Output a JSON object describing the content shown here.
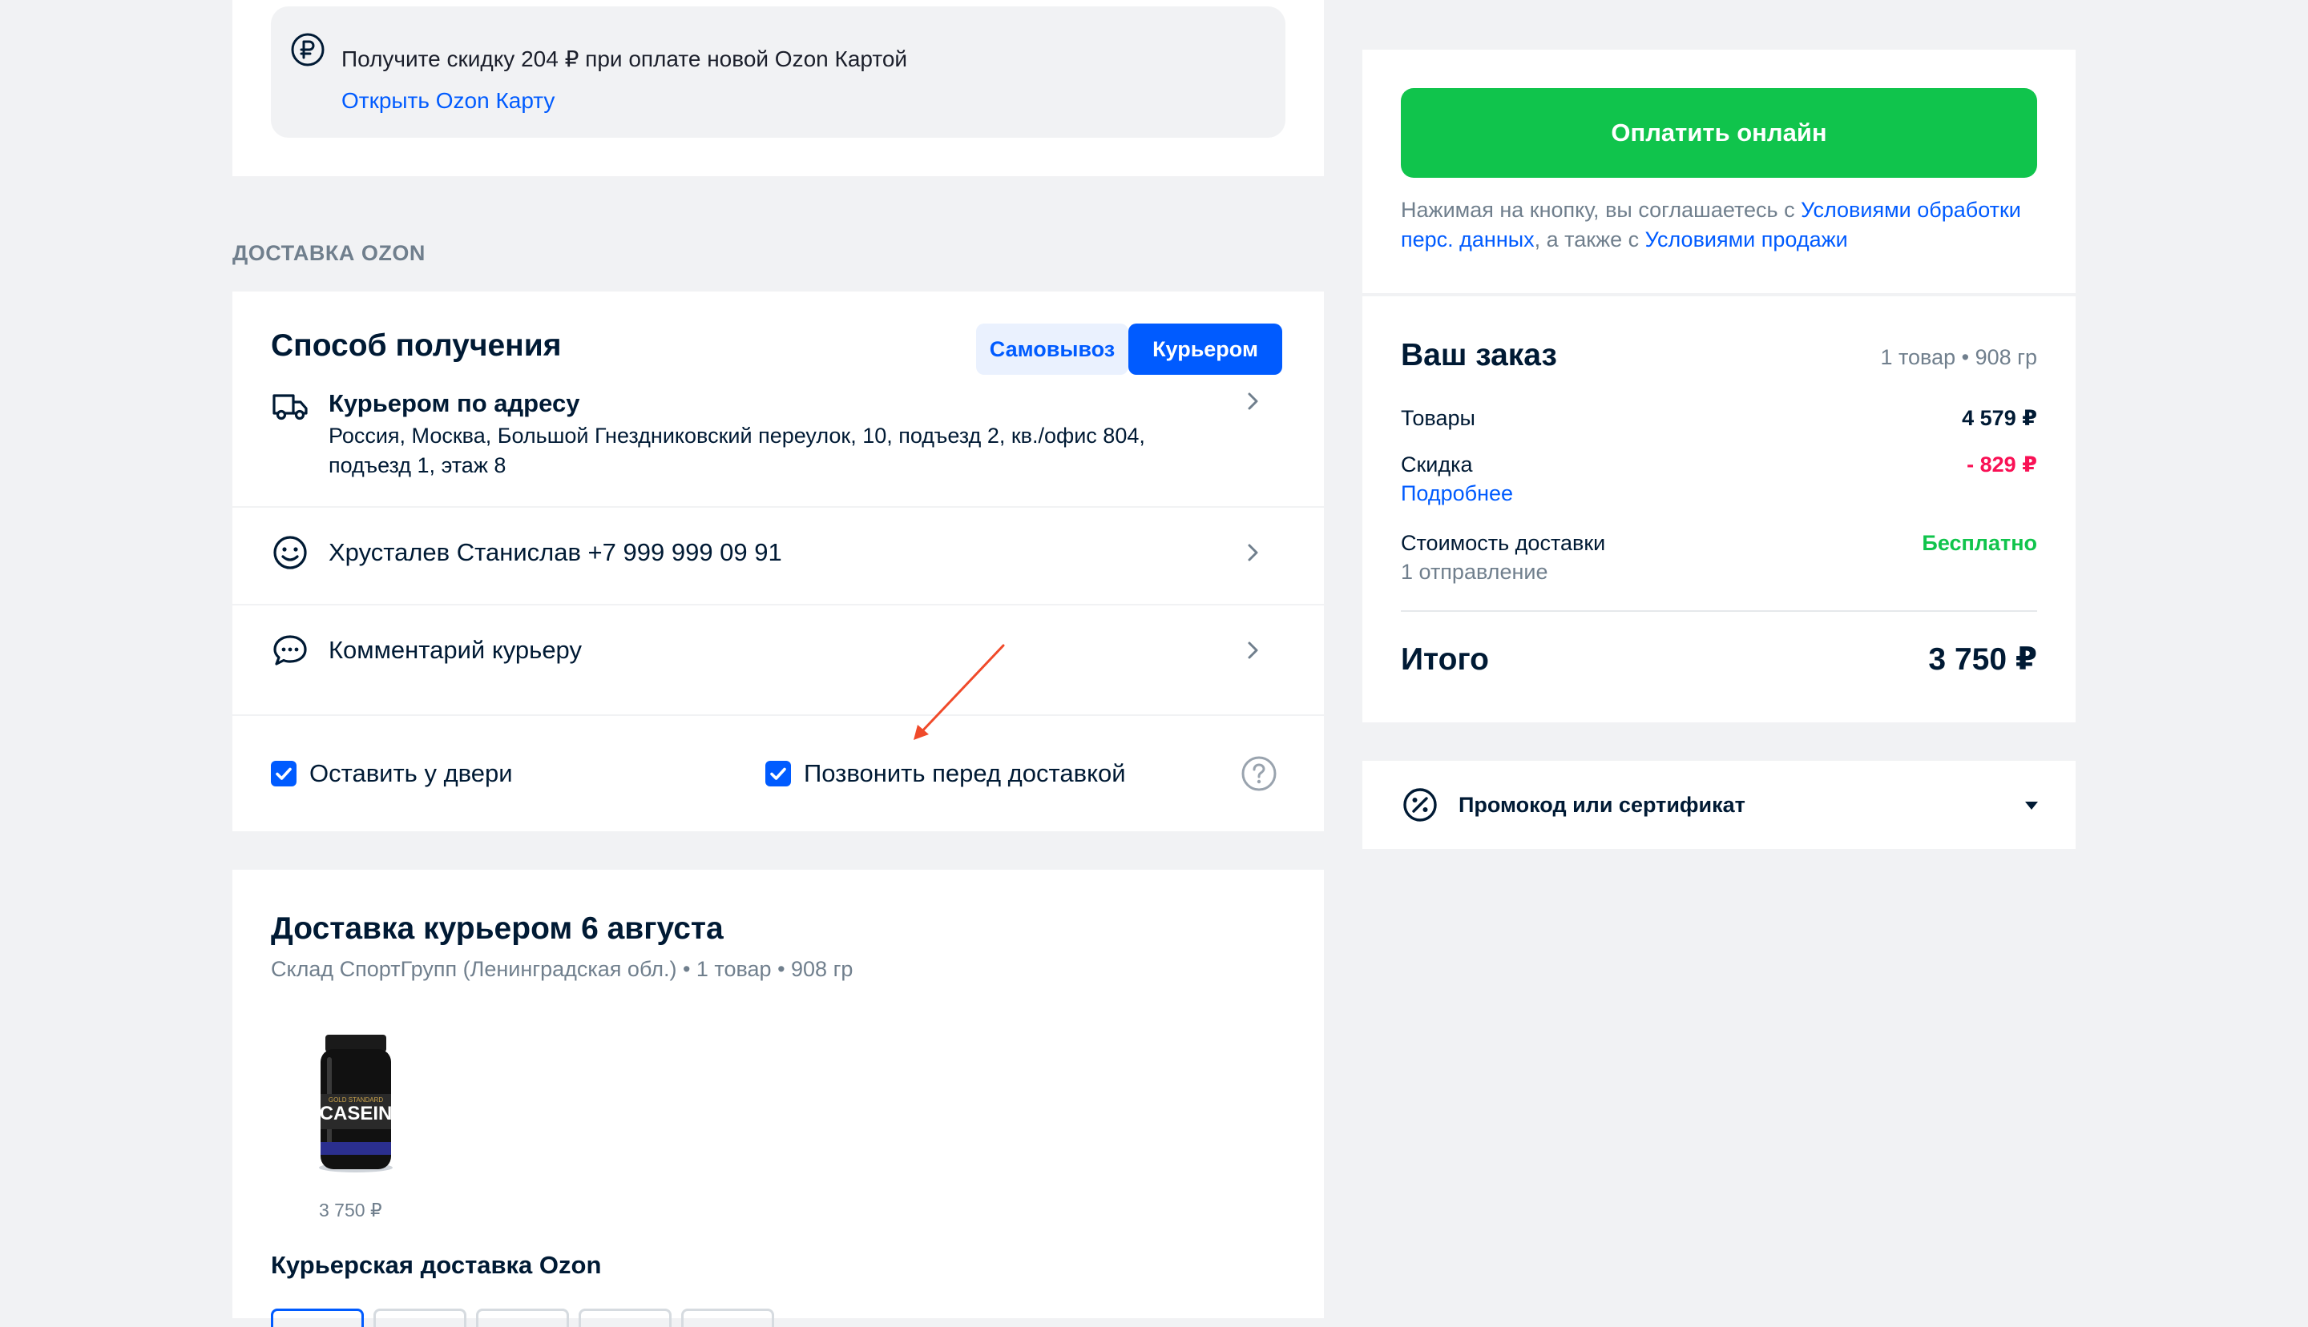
{
  "discount": {
    "text": "Получите скидку 204 ₽ при оплате новой Ozon Картой",
    "link": "Открыть Ozon Карту"
  },
  "section_label": "ДОСТАВКА OZON",
  "delivery": {
    "title": "Способ получения",
    "tabs": [
      {
        "label": "Самовывоз",
        "selected": false
      },
      {
        "label": "Курьером",
        "selected": true
      }
    ],
    "address": {
      "title": "Курьером по адресу",
      "text": "Россия, Москва, Большой Гнездниковский переулок, 10, подъезд 2, кв./офис 804, подъезд 1, этаж 8"
    },
    "contact": "Хрусталев Станислав +7 999 999 09 91",
    "comment": "Комментарий курьеру",
    "options": [
      {
        "label": "Оставить у двери",
        "checked": true
      },
      {
        "label": "Позвонить перед доставкой",
        "checked": true
      }
    ]
  },
  "shipment": {
    "title": "Доставка курьером 6 августа",
    "subtitle": "Склад СпортГрупп (Ленинградская обл.) • 1 товар • 908 гр",
    "product_price": "3 750 ₽",
    "product_label": "CASEIN",
    "product_label_top": "GOLD STANDARD",
    "method": "Курьерская доставка Ozon"
  },
  "payment": {
    "button": "Оплатить онлайн",
    "agree_prefix": "Нажимая на кнопку, вы соглашаетесь с ",
    "agree_link1": "Условиями обработки перс. данных",
    "agree_middle": ", а также с ",
    "agree_link2": "Условиями продажи"
  },
  "order": {
    "title": "Ваш заказ",
    "meta": "1 товар • 908 гр",
    "goods_label": "Товары",
    "goods_value": "4 579 ₽",
    "discount_label": "Скидка",
    "discount_value": "- 829 ₽",
    "details_link": "Подробнее",
    "delivery_label": "Стоимость доставки",
    "delivery_value": "Бесплатно",
    "shipments": "1  отправление",
    "total_label": "Итого",
    "total_value": "3 750 ₽"
  },
  "promo": {
    "label": "Промокод или сертификат"
  },
  "colors": {
    "accent": "#005bff",
    "pay_green": "#10c44c",
    "discount_red": "#f91155",
    "free_green": "#10c44c",
    "annotation_arrow": "#f04a2a"
  },
  "icons": [
    "ruble-icon",
    "truck-icon",
    "smile-icon",
    "chat-icon",
    "chevron-right-icon",
    "checkbox-checked-icon",
    "help-icon",
    "percent-badge-icon",
    "caret-down-icon"
  ]
}
